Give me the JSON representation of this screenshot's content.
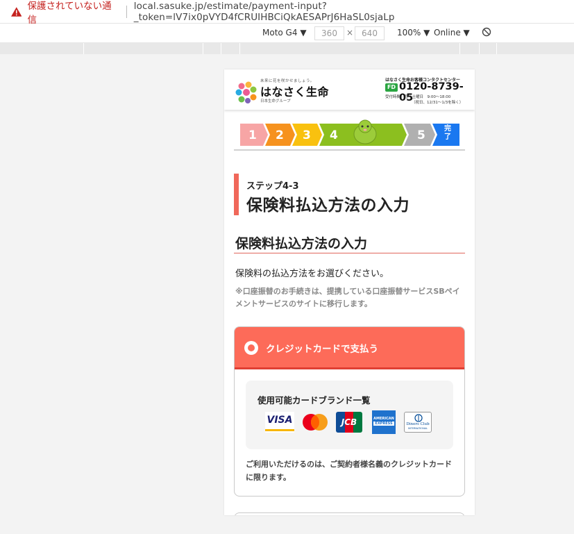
{
  "browser": {
    "security_label": "保護されていない通信",
    "url": "local.sasuke.jp/estimate/payment-input?_token=lV7ix0pVYD4fCRUIHBCiQkAESAPrJ6HaSL0sjaLp"
  },
  "devtools": {
    "device": "Moto G4",
    "width": "360",
    "times": "×",
    "height": "640",
    "zoom": "100%",
    "network": "Online"
  },
  "header": {
    "tagline": "未来に花を咲かせましょう。",
    "brand": "はなさく生命",
    "brand_sub": "日本生命グループ",
    "contact_title": "はなさく生命お客様コンタクトセンター",
    "freedial": "FD",
    "phone": "0120-8739-05",
    "hours": "受付時間　月～土曜日　9:00～18:00",
    "hours_note": "（祝日、12/31～1/3を除く）"
  },
  "steps": {
    "s1": "1",
    "s2": "2",
    "s3": "3",
    "s4": "4",
    "s5": "5",
    "done_a": "完",
    "done_b": "了",
    "current": 4,
    "colors": {
      "s1": "#f7a5a5",
      "s2": "#f6921e",
      "s3": "#f9c10f",
      "s4": "#8cbf1f",
      "s5": "#b0b0b0",
      "done": "#1a78f0"
    }
  },
  "page": {
    "step_label": "ステップ4-3",
    "title": "保険料払込方法の入力",
    "section_title": "保険料払込方法の入力",
    "lead": "保険料の払込方法をお選びください。",
    "note": "※口座振替のお手続きは、提携している口座振替サービスSBペイメントサービスのサイトに移行します。"
  },
  "payment": {
    "option_label": "クレジットカードで支払う",
    "brands_title": "使用可能カードブランド一覧",
    "brands": {
      "visa": "VISA",
      "jcb": "JCB",
      "amex_a": "AMERICAN",
      "amex_b": "EXPRESS",
      "diners_a": "Diners Club",
      "diners_b": "INTERNATIONAL"
    },
    "note": "ご利用いただけるのは、ご契約者様名義のクレジットカードに限ります。"
  }
}
